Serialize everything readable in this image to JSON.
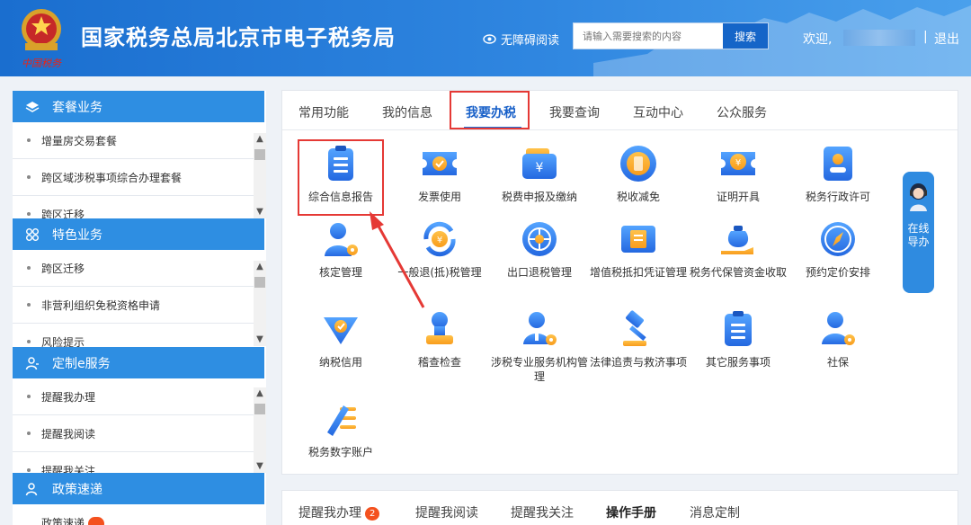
{
  "header": {
    "title": "国家税务总局北京市电子税务局",
    "emblem_text": "中国税务",
    "accessibility": "无障碍阅读",
    "search": {
      "placeholder": "请输入需要搜索的内容",
      "button": "搜索"
    },
    "welcome": "欢迎,",
    "separator": "|",
    "logout": "退出"
  },
  "sidebar": {
    "sections": [
      {
        "title": "套餐业务",
        "icon": "layers-icon",
        "items": [
          "增量房交易套餐",
          "跨区域涉税事项综合办理套餐",
          "跨区迁移"
        ]
      },
      {
        "title": "特色业务",
        "icon": "grid-icon",
        "items": [
          "跨区迁移",
          "非营利组织免税资格申请",
          "风险提示"
        ]
      },
      {
        "title": "定制e服务",
        "icon": "user-icon",
        "items": [
          "提醒我办理",
          "提醒我阅读",
          "提醒我关注"
        ]
      },
      {
        "title": "政策速递",
        "icon": "user-icon",
        "items": [
          "政策速递"
        ]
      }
    ]
  },
  "main": {
    "tabs": [
      "常用功能",
      "我的信息",
      "我要办税",
      "我要查询",
      "互动中心",
      "公众服务"
    ],
    "active_tab": "我要办税",
    "items": [
      {
        "label": "综合信息报告",
        "icon": "document-report-icon"
      },
      {
        "label": "发票使用",
        "icon": "invoice-ticket-icon"
      },
      {
        "label": "税费申报及缴纳",
        "icon": "wallet-yuan-icon"
      },
      {
        "label": "税收减免",
        "icon": "tax-reduction-icon"
      },
      {
        "label": "证明开具",
        "icon": "certificate-yuan-icon"
      },
      {
        "label": "税务行政许可",
        "icon": "license-person-icon"
      },
      {
        "label": "核定管理",
        "icon": "user-gear-icon"
      },
      {
        "label": "一般退(抵)税管理",
        "icon": "refund-cycle-icon"
      },
      {
        "label": "出口退税管理",
        "icon": "globe-export-icon"
      },
      {
        "label": "增值税抵扣凭证管理",
        "icon": "vat-voucher-icon"
      },
      {
        "label": "税务代保管资金收取",
        "icon": "money-bag-hand-icon"
      },
      {
        "label": "预约定价安排",
        "icon": "compass-icon"
      },
      {
        "label": "纳税信用",
        "icon": "credit-shield-icon"
      },
      {
        "label": "稽查检查",
        "icon": "inspection-stamp-icon"
      },
      {
        "label": "涉税专业服务机构管理",
        "icon": "agent-gear-icon"
      },
      {
        "label": "法律追责与救济事项",
        "icon": "gavel-icon"
      },
      {
        "label": "其它服务事项",
        "icon": "clipboard-list-icon"
      },
      {
        "label": "社保",
        "icon": "social-security-icon"
      },
      {
        "label": "税务数字账户",
        "icon": "digital-account-icon"
      }
    ]
  },
  "online_guide": "在线导办",
  "bottom_tabs": [
    {
      "label": "提醒我办理",
      "badge": "2"
    },
    {
      "label": "提醒我阅读"
    },
    {
      "label": "提醒我关注"
    },
    {
      "label": "操作手册"
    },
    {
      "label": "消息定制"
    }
  ],
  "colors": {
    "brand": "#1a6ecf",
    "accent": "#2e8ee2",
    "highlight": "#e53935",
    "icon_blue": "#2f7fe6"
  }
}
